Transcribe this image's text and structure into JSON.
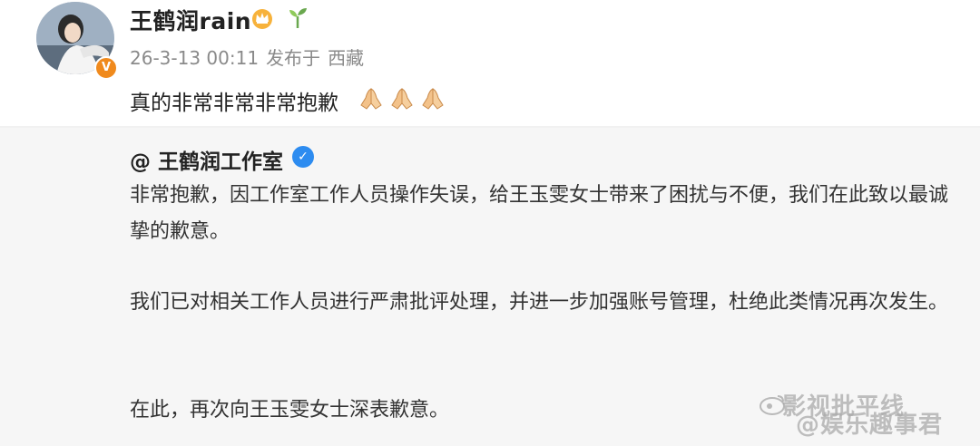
{
  "post": {
    "username": "王鹤润rain",
    "badges": [
      "crown-icon",
      "sprout-icon"
    ],
    "verified_badge": "V",
    "timestamp": "26-3-13 00:11",
    "published_at_label": "发布于",
    "location": "西藏",
    "text": "真的非常非常非常抱歉",
    "emojis": [
      "praying-hands-icon",
      "praying-hands-icon",
      "praying-hands-icon"
    ]
  },
  "quoted": {
    "author": "@ 王鹤润工作室",
    "verified_badge": "✓",
    "paragraphs": [
      "非常抱歉，因工作室工作人员操作失误，给王玉雯女士带来了困扰与不便，我们在此致以最诚挚的歉意。",
      "我们已对相关工作人员进行严肃批评处理，并进一步加强账号管理，杜绝此类情况再次发生。",
      "在此，再次向王玉雯女士深表歉意。"
    ]
  },
  "watermarks": {
    "line1": "影视批平线",
    "line2": "@娱乐趣事君"
  },
  "colors": {
    "orange_badge": "#f08a1d",
    "blue_badge": "#2d8cf0",
    "meta_gray": "#8a8a8a"
  }
}
